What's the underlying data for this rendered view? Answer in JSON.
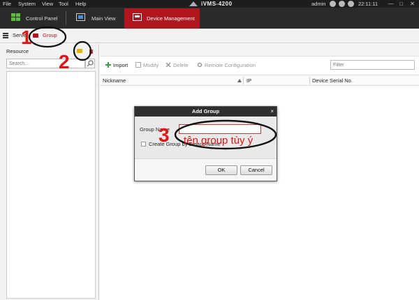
{
  "menubar": {
    "items": [
      "File",
      "System",
      "View",
      "Tool",
      "Help"
    ],
    "app_title": "iVMS-4200",
    "user": "admin",
    "clock": "22:11:11",
    "window_buttons": [
      "—",
      "□",
      "✕"
    ]
  },
  "tabs": [
    {
      "label": "Control Panel",
      "icon": "control-panel-icon",
      "active": false
    },
    {
      "label": "Main View",
      "icon": "main-view-icon",
      "active": false
    },
    {
      "label": "Device Management",
      "icon": "device-management-icon",
      "active": true
    }
  ],
  "breadcrumb": {
    "items": [
      {
        "label": "Serve",
        "active": false
      },
      {
        "label": "Group",
        "active": true
      }
    ]
  },
  "left_panel": {
    "title": "Resource",
    "search_placeholder": "Search..."
  },
  "toolbar": {
    "import": "Import",
    "modify": "Modify",
    "delete": "Delete",
    "remote_config": "Remote Configuration",
    "filter_placeholder": "Filter"
  },
  "table": {
    "columns": [
      "Nickname",
      "IP",
      "Device Serial No."
    ]
  },
  "dialog": {
    "title": "Add Group",
    "close": "×",
    "group_name_label": "Group Name",
    "group_name_value": "",
    "create_checkbox_label": "Create Group by Device Name",
    "ok": "OK",
    "cancel": "Cancel"
  },
  "annotations": {
    "n1": "1",
    "n2": "2",
    "n3": "3",
    "note": "tên group tùy ý"
  },
  "colors": {
    "accent": "#b1161c",
    "annotation": "#e51414"
  }
}
